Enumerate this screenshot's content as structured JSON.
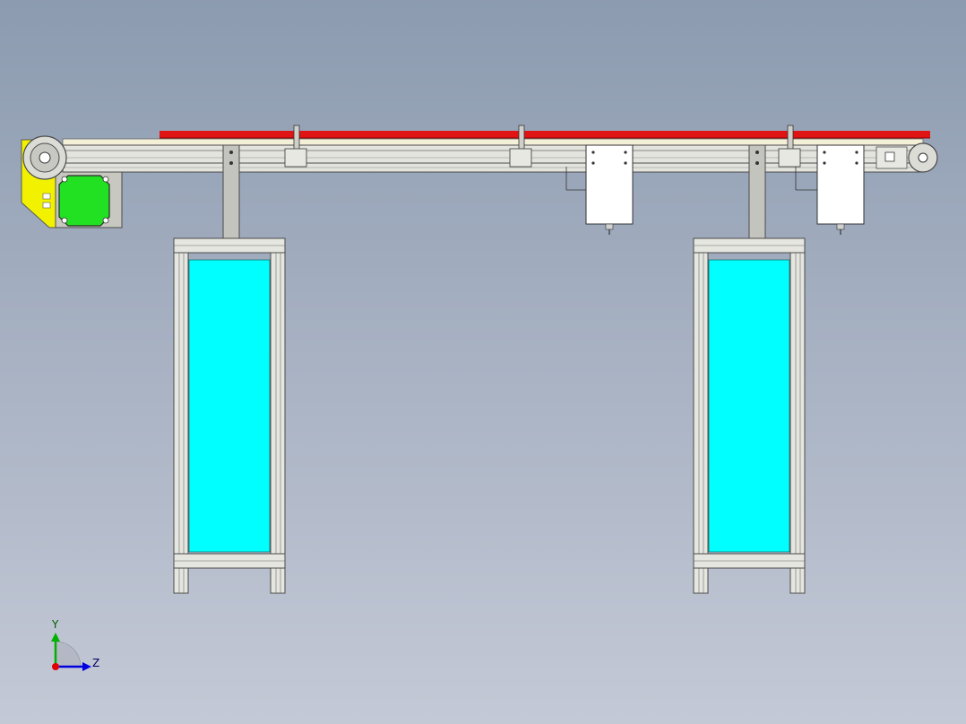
{
  "viewport": {
    "background_top": "#8c9bb0",
    "background_bottom": "#c4c9d6"
  },
  "colors": {
    "belt": "#e01414",
    "motor": "#22e022",
    "motor_bracket": "#f2f200",
    "panel_glass": "#00ffff",
    "frame": "#d8d8d0",
    "frame_edge": "#5a5a5a",
    "box": "#ffffff",
    "axis_x": "#e00000",
    "axis_y": "#00b000",
    "axis_z": "#0000e0"
  },
  "triad": {
    "y_label": "Y",
    "z_label": "Z"
  }
}
